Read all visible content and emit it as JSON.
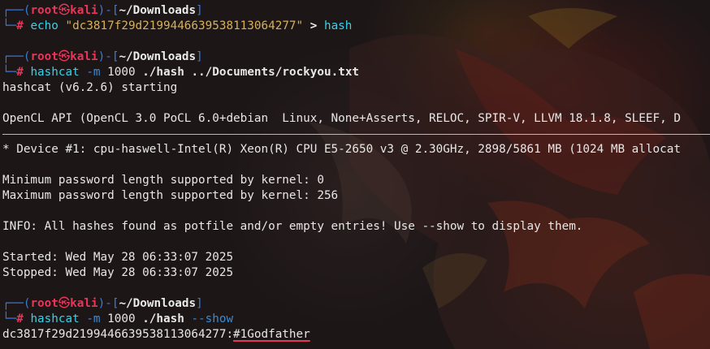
{
  "prompt": {
    "user": "root",
    "skull": "㉿",
    "host": "kali",
    "dir": "~/Downloads",
    "hash_char": "#"
  },
  "cmd1": {
    "command": "echo",
    "string": "\"dc3817f29d2199446639538113064277\"",
    "redirect": ">",
    "target": "hash"
  },
  "cmd2": {
    "command": "hashcat",
    "opt": "-m",
    "mode": "1000",
    "file": "./hash",
    "wordlist": "../Documents/rockyou.txt"
  },
  "output1": {
    "starting": "hashcat (v6.2.6) starting",
    "opencl": "OpenCL API (OpenCL 3.0 PoCL 6.0+debian  Linux, None+Asserts, RELOC, SPIR-V, LLVM 18.1.8, SLEEF, D",
    "device": "* Device #1: cpu-haswell-Intel(R) Xeon(R) CPU E5-2650 v3 @ 2.30GHz, 2898/5861 MB (1024 MB allocat",
    "min_len": "Minimum password length supported by kernel: 0",
    "max_len": "Maximum password length supported by kernel: 256",
    "info": "INFO: All hashes found as potfile and/or empty entries! Use --show to display them.",
    "started": "Started: Wed May 28 06:33:07 2025",
    "stopped": "Stopped: Wed May 28 06:33:07 2025"
  },
  "cmd3": {
    "command": "hashcat",
    "opt": "-m",
    "mode": "1000",
    "file": "./hash",
    "flag": "--show"
  },
  "result": {
    "hash": "dc3817f29d2199446639538113064277:",
    "password": "#1Godfather"
  }
}
